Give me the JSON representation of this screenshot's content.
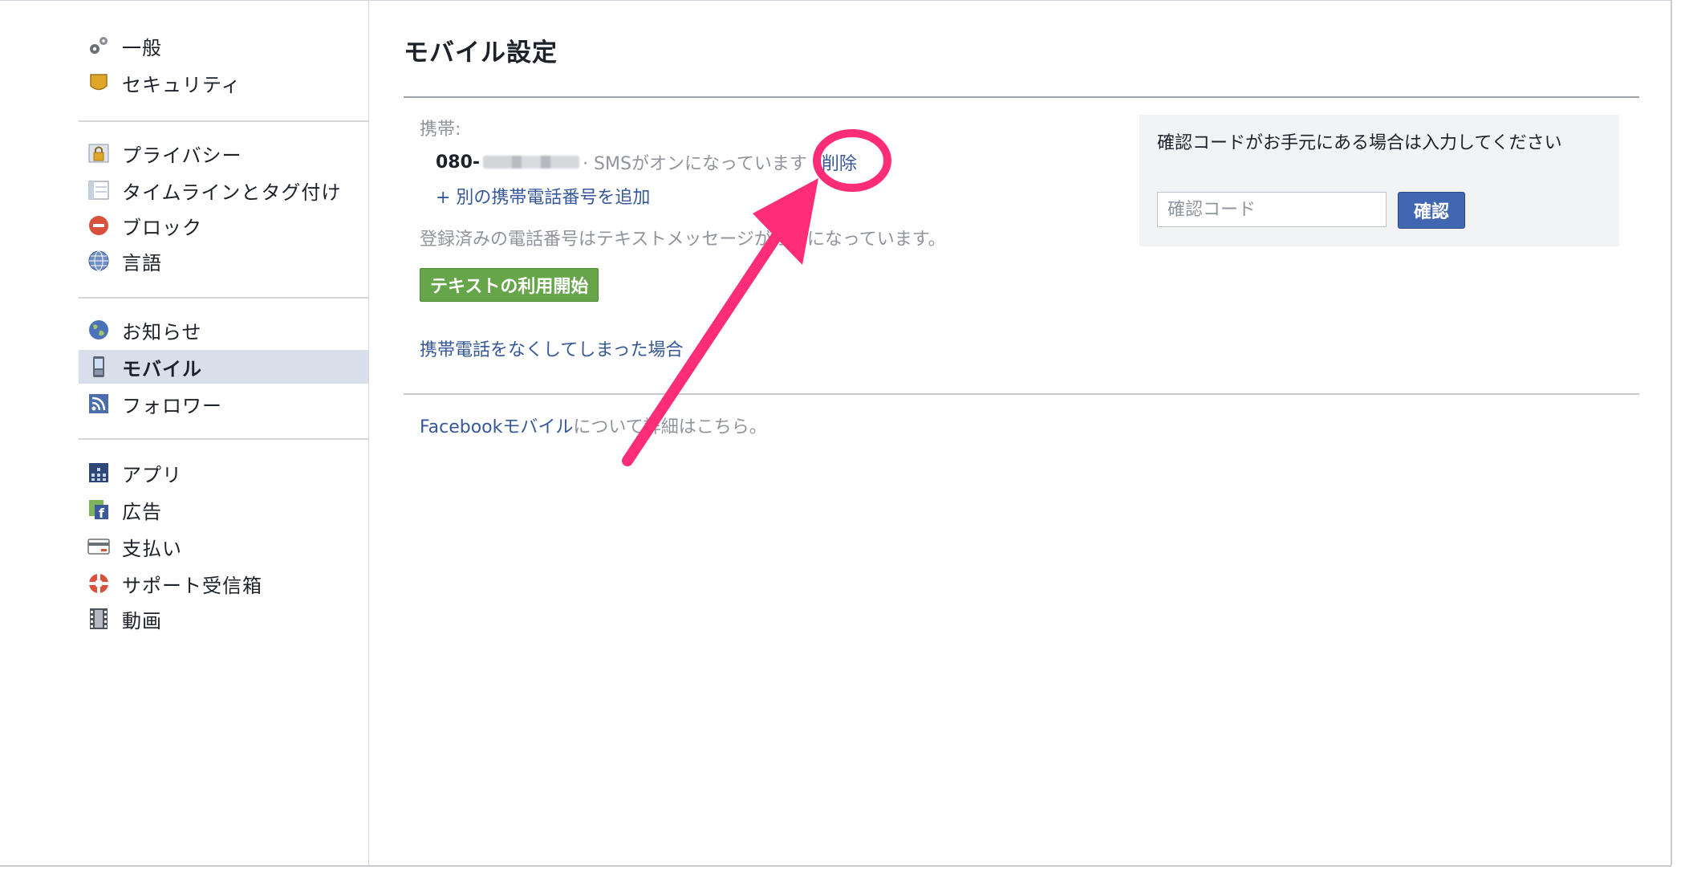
{
  "sidebar": {
    "groups": [
      [
        {
          "label": "一般",
          "icon": "gears-icon"
        },
        {
          "label": "セキュリティ",
          "icon": "shield-badge-icon"
        }
      ],
      [
        {
          "label": "プライバシー",
          "icon": "lock-icon"
        },
        {
          "label": "タイムラインとタグ付け",
          "icon": "timeline-icon"
        },
        {
          "label": "ブロック",
          "icon": "block-icon"
        },
        {
          "label": "言語",
          "icon": "globe-grid-icon"
        }
      ],
      [
        {
          "label": "お知らせ",
          "icon": "globe-icon"
        },
        {
          "label": "モバイル",
          "icon": "mobile-phone-icon",
          "selected": true
        },
        {
          "label": "フォロワー",
          "icon": "rss-icon"
        }
      ],
      [
        {
          "label": "アプリ",
          "icon": "apps-grid-icon"
        },
        {
          "label": "広告",
          "icon": "ads-icon"
        },
        {
          "label": "支払い",
          "icon": "credit-card-icon"
        },
        {
          "label": "サポート受信箱",
          "icon": "lifebuoy-icon"
        },
        {
          "label": "動画",
          "icon": "film-icon"
        }
      ]
    ]
  },
  "main": {
    "title": "モバイル設定",
    "mobile_label": "携帯:",
    "phone_prefix": "080-",
    "phone_status": "· SMSがオンになっています ·",
    "delete_link": "削除",
    "add_phone_link": "+ 別の携帯電話番号を追加",
    "registered_note": "登録済みの電話番号はテキストメッセージがオフになっています。",
    "start_text_button": "テキストの利用開始",
    "lost_phone_link": "携帯電話をなくしてしまった場合",
    "footer_link": "Facebookモバイル",
    "footer_rest": "について詳細はこちら。"
  },
  "confirm": {
    "prompt": "確認コードがお手元にある場合は入力してください",
    "placeholder": "確認コード",
    "button": "確認"
  },
  "colors": {
    "link": "#365899",
    "muted": "#90949c",
    "selected_bg": "#d8dfea",
    "green_button": "#67a54b",
    "confirm_button": "#4267b2",
    "annotation": "#ff2d78"
  }
}
